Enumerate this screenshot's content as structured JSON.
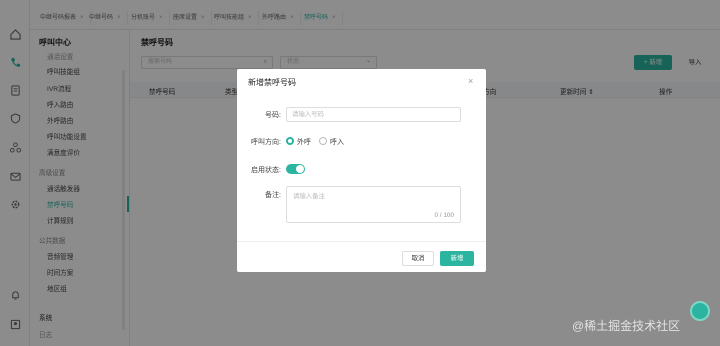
{
  "tabs": [
    {
      "label": "中继号码报表",
      "close": "×"
    },
    {
      "label": "中继号码",
      "close": "×"
    },
    {
      "label": "分机账号",
      "close": "×"
    },
    {
      "label": "座席设置",
      "close": "×"
    },
    {
      "label": "呼叫技能组",
      "close": "×"
    },
    {
      "label": "外呼路由",
      "close": "×"
    },
    {
      "label": "禁呼号码",
      "close": "×"
    }
  ],
  "rail_icons": [
    "home-icon",
    "phone-icon",
    "document-icon",
    "shield-icon",
    "network-icon",
    "mail-icon",
    "settings-icon",
    "bell-icon",
    "user-box-icon"
  ],
  "menu": {
    "header": "呼叫中心",
    "cut_item": "通话设置",
    "items_top": [
      "呼叫技能组",
      "IVR流程",
      "呼入路由",
      "外呼路由",
      "呼叫功能设置",
      "满意度评价"
    ],
    "group_advanced": "高级设置",
    "items_advanced": [
      "通话触发器",
      "禁呼号码",
      "计算规则"
    ],
    "group_public": "公共数据",
    "items_public": [
      "音频管理",
      "时间方案",
      "地区组"
    ],
    "group_system": "系统",
    "cut_bottom": "日志"
  },
  "page": {
    "title": "禁呼号码",
    "search_placeholder": "搜索号码",
    "search_icon": "⌕",
    "status_placeholder": "状态",
    "new_button": "+ 新增",
    "import_button": "导入",
    "columns": [
      "禁呼号码",
      "类型",
      "呼叫方向",
      "更新时间 ⇕",
      "操作"
    ]
  },
  "modal": {
    "title": "新增禁呼号码",
    "close": "×",
    "number_label": "号码:",
    "number_placeholder": "请输入号码",
    "direction_label": "呼叫方向:",
    "direction_options": [
      "外呼",
      "呼入"
    ],
    "status_label": "启用状态:",
    "note_label": "备注:",
    "note_placeholder": "请输入备注",
    "note_counter": "0 / 100",
    "cancel_button": "取消",
    "confirm_button": "新增"
  },
  "watermark": "@稀土掘金技术社区",
  "colors": {
    "accent": "#2bb5a0"
  }
}
